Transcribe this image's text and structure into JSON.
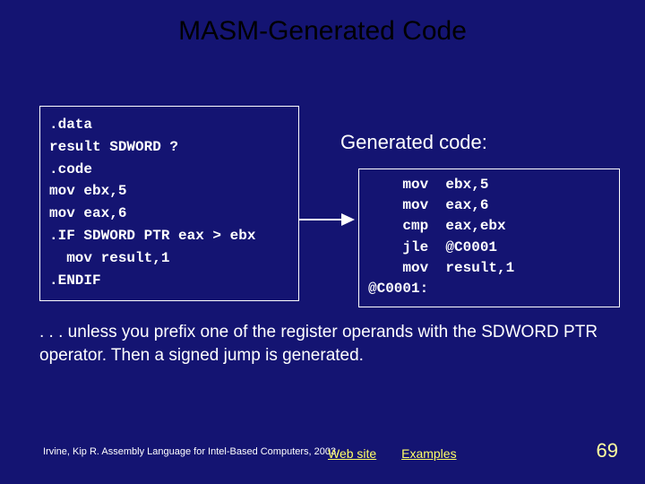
{
  "title": "MASM-Generated Code",
  "left_code": ".data\nresult SDWORD ?\n.code\nmov ebx,5\nmov eax,6\n.IF SDWORD PTR eax > ebx\n  mov result,1\n.ENDIF",
  "gen_label": "Generated code:",
  "right_code": "    mov  ebx,5\n    mov  eax,6\n    cmp  eax,ebx\n    jle  @C0001\n    mov  result,1\n@C0001:",
  "body": ". . . unless you prefix one of the register operands with the SDWORD PTR operator. Then a signed jump is generated.",
  "footer": "Irvine, Kip R. Assembly Language for Intel-Based Computers, 2003.",
  "links": {
    "site": "Web site",
    "examples": "Examples"
  },
  "page": "69"
}
